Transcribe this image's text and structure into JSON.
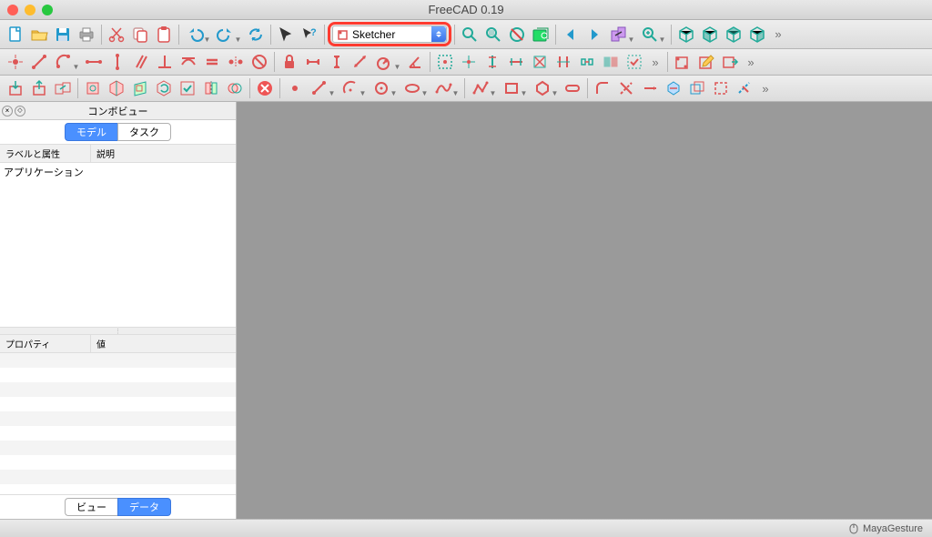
{
  "window": {
    "title": "FreeCAD 0.19"
  },
  "workbench": {
    "selected": "Sketcher"
  },
  "panel": {
    "title": "コンボビュー",
    "tabs": {
      "model": "モデル",
      "task": "タスク"
    },
    "tree_col1": "ラベルと属性",
    "tree_col2": "説明",
    "tree_root": "アプリケーション",
    "prop_col1": "プロパティ",
    "prop_col2": "値",
    "bottom_view": "ビュー",
    "bottom_data": "データ"
  },
  "status": {
    "nav_style": "MayaGesture"
  },
  "colors": {
    "accent_red": "#d66",
    "accent_teal": "#2a9",
    "accent_blue": "#29c"
  }
}
